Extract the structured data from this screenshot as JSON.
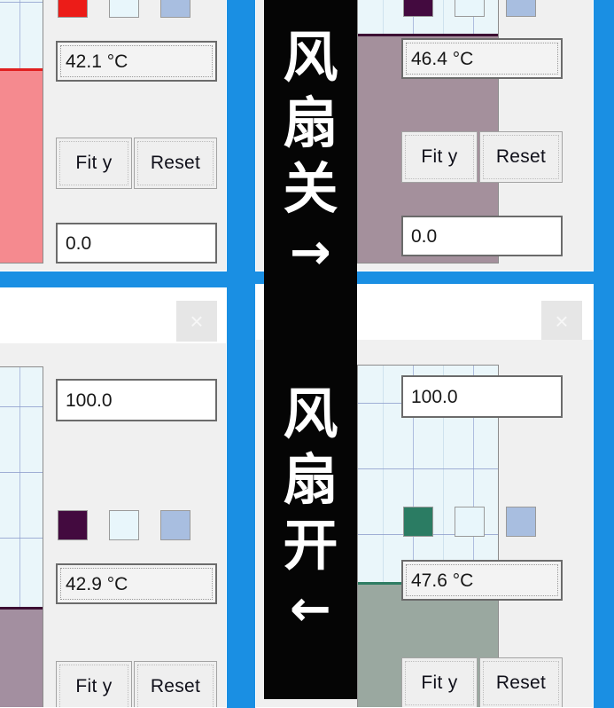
{
  "background": {
    "color": "#1a8fe3"
  },
  "banner": {
    "background": "#050505",
    "text_color": "#ffffff",
    "top": {
      "line1": "风",
      "line2": "扇",
      "line3": "关",
      "arrow": "→",
      "meaning": "Fan off"
    },
    "bottom": {
      "line1": "风",
      "line2": "扇",
      "line3": "开",
      "arrow": "←",
      "meaning": "Fan on"
    }
  },
  "windows": [
    {
      "id": "top-left",
      "close_label": "×",
      "close_visible": false,
      "plot": {
        "fill_color": "#f58a8f",
        "line_color": "#e02020",
        "background": "#eaf6fa",
        "fill_level_pct": 61
      },
      "swatches": [
        {
          "name": "series-color",
          "color": "#ec1c18"
        },
        {
          "name": "fill-color",
          "color": "#e8f6fb"
        },
        {
          "name": "grid-color",
          "color": "#a8bee0"
        }
      ],
      "temperature_field": {
        "value": "42.1 °C",
        "focused": true
      },
      "limit_field": {
        "value": "0.0",
        "focused": false
      },
      "buttons": {
        "fit_y": "Fit y",
        "reset": "Reset"
      }
    },
    {
      "id": "top-right",
      "close_label": "×",
      "close_visible": false,
      "plot": {
        "fill_color": "#a4909c",
        "line_color": "#3d0f33",
        "background": "#eaf6fa",
        "fill_level_pct": 72
      },
      "swatches": [
        {
          "name": "series-color",
          "color": "#430a3f"
        },
        {
          "name": "fill-color",
          "color": "#e8f6fb"
        },
        {
          "name": "grid-color",
          "color": "#a8bee0"
        }
      ],
      "temperature_field": {
        "value": "46.4 °C",
        "focused": true
      },
      "limit_field": {
        "value": "0.0",
        "focused": false
      },
      "buttons": {
        "fit_y": "Fit y",
        "reset": "Reset"
      }
    },
    {
      "id": "bottom-left",
      "close_label": "×",
      "close_visible": true,
      "plot": {
        "fill_color": "#a38fa0",
        "line_color": "#3d0f33",
        "background": "#eaf6fa",
        "fill_level_pct": 29
      },
      "swatches": [
        {
          "name": "series-color",
          "color": "#430a3f"
        },
        {
          "name": "fill-color",
          "color": "#e8f6fb"
        },
        {
          "name": "grid-color",
          "color": "#a8bee0"
        }
      ],
      "scale_field": {
        "value": "100.0",
        "focused": false
      },
      "temperature_field": {
        "value": "42.9 °C",
        "focused": true
      },
      "buttons": {
        "fit_y": "Fit y",
        "reset": "Reset"
      }
    },
    {
      "id": "bottom-right",
      "close_label": "×",
      "close_visible": true,
      "plot": {
        "fill_color": "#9aa8a0",
        "line_color": "#2e7d63",
        "background": "#eaf6fa",
        "fill_level_pct": 36
      },
      "swatches": [
        {
          "name": "series-color",
          "color": "#2b7c63"
        },
        {
          "name": "fill-color",
          "color": "#e8f6fb"
        },
        {
          "name": "grid-color",
          "color": "#a8bee0"
        }
      ],
      "scale_field": {
        "value": "100.0",
        "focused": false
      },
      "temperature_field": {
        "value": "47.6 °C",
        "focused": true
      },
      "buttons": {
        "fit_y": "Fit y",
        "reset": "Reset"
      }
    }
  ]
}
